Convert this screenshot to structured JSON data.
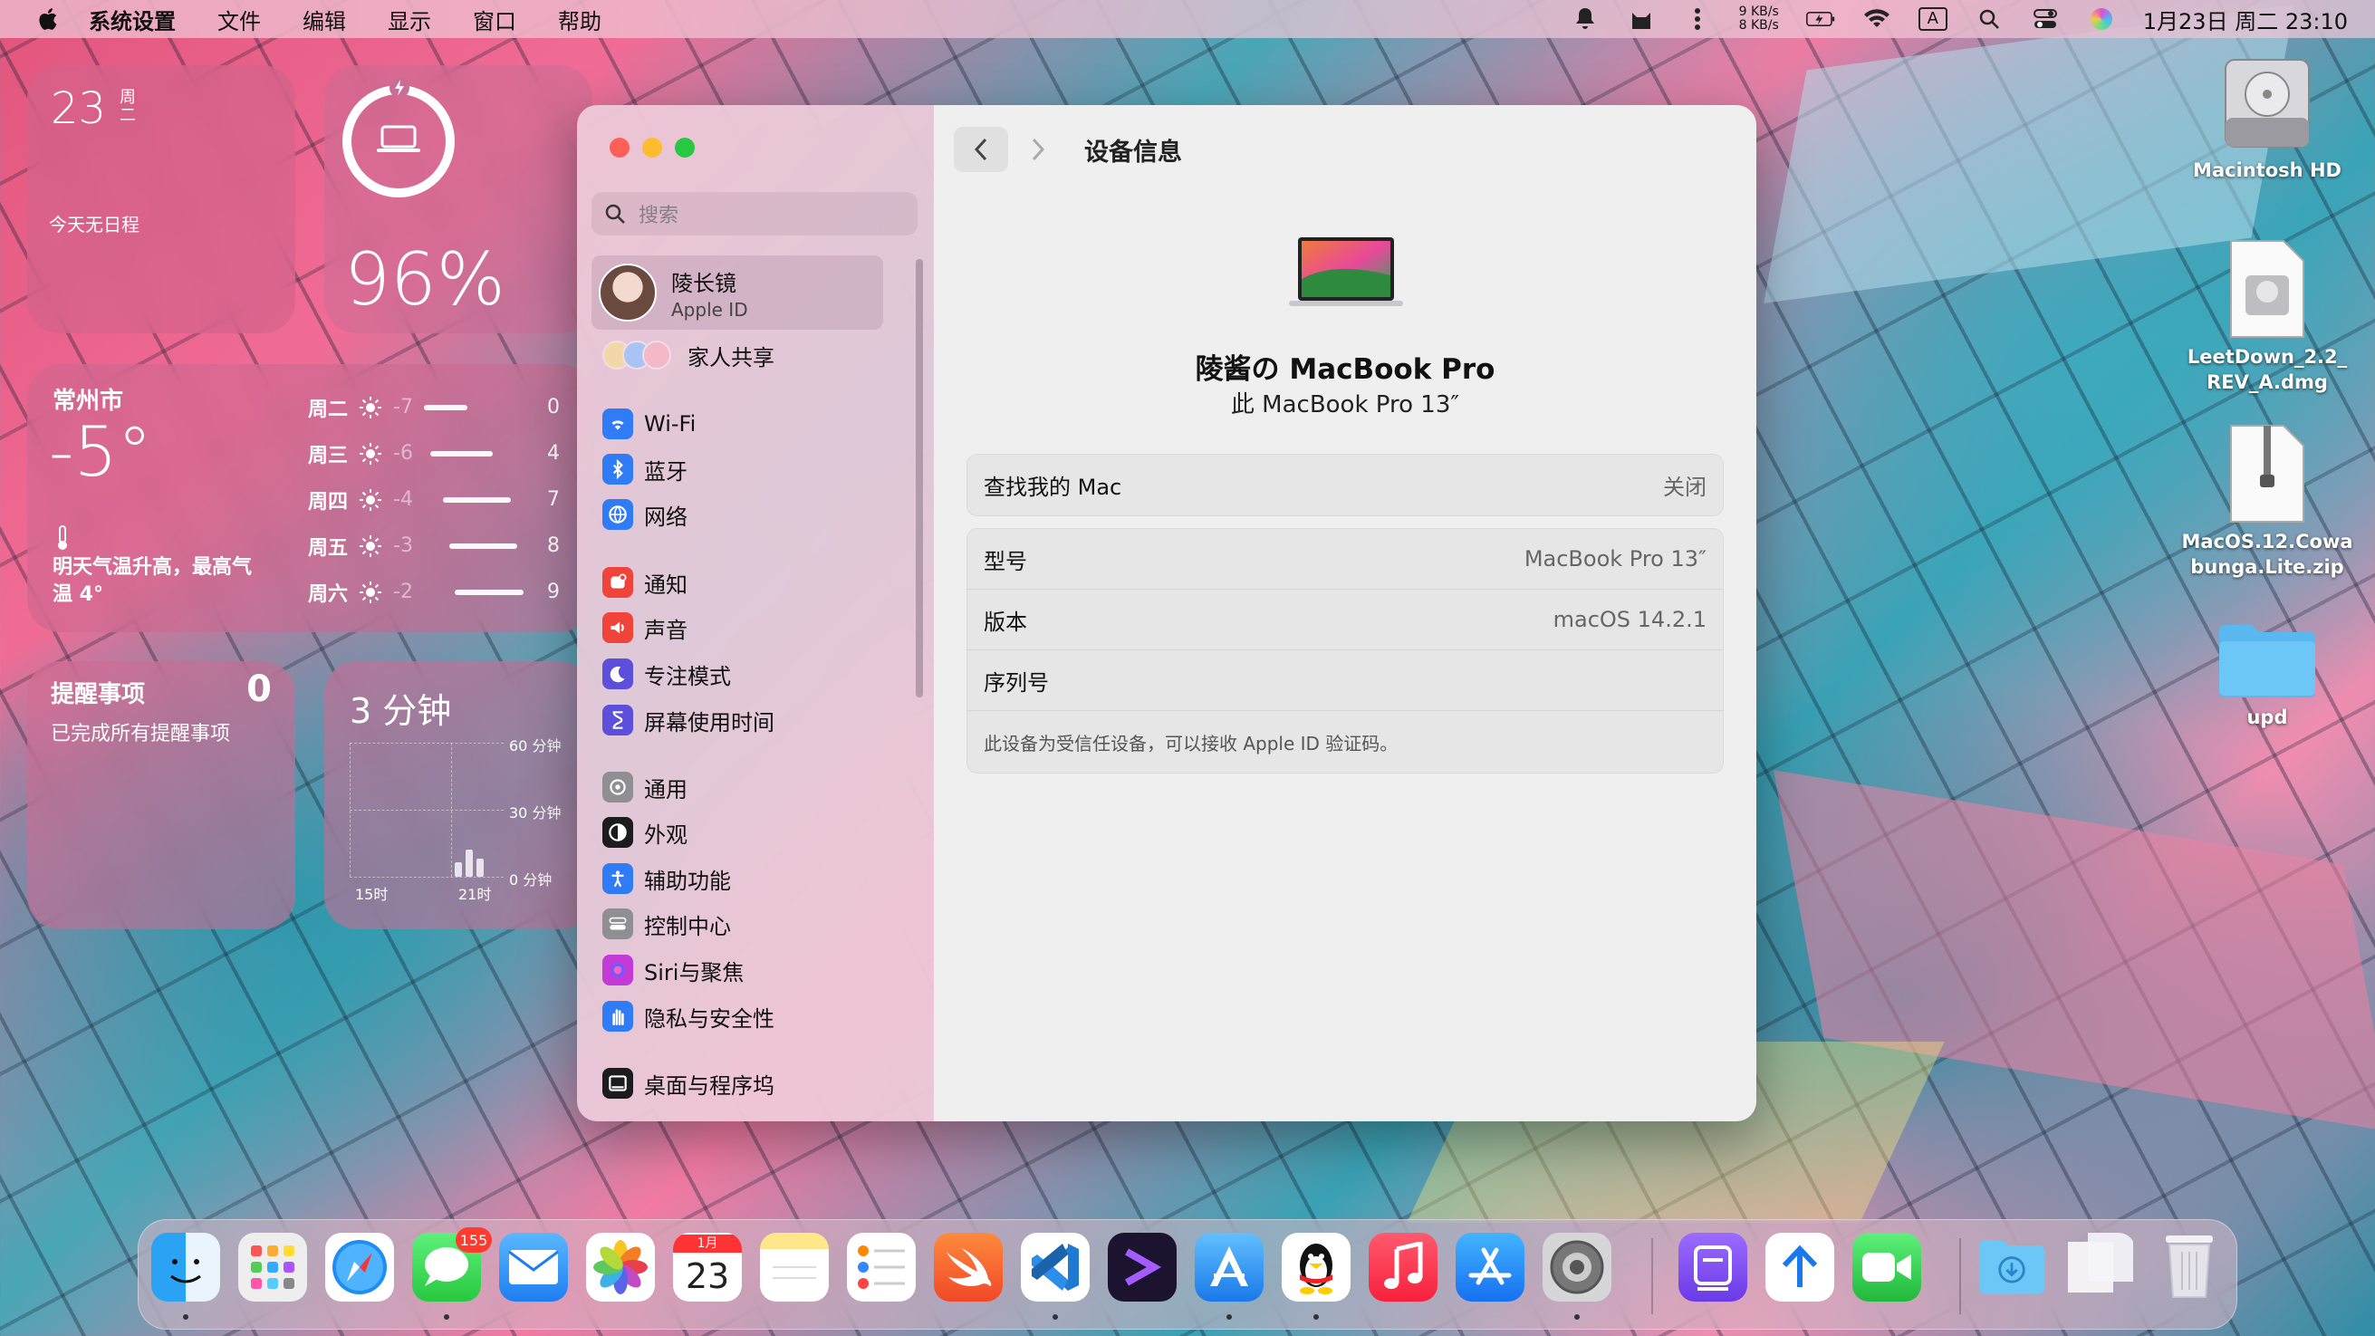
{
  "menubar": {
    "app_name": "系统设置",
    "menus": [
      "文件",
      "编辑",
      "显示",
      "窗口",
      "帮助"
    ],
    "net_up": "9 KB/s",
    "net_down": "8 KB/s",
    "input_method": "A",
    "clock": "1月23日 周二  23:10"
  },
  "widgets": {
    "calendar": {
      "day": "23",
      "weekday": "周二",
      "no_events": "今天无日程"
    },
    "battery": {
      "percent_text": "96%",
      "level": 0.96
    },
    "weather": {
      "city": "常州市",
      "temp": "-5°",
      "note": "明天气温升高，最高气温 4°",
      "forecast": [
        {
          "day": "周二",
          "low": "-7",
          "high": "0"
        },
        {
          "day": "周三",
          "low": "-6",
          "high": "4"
        },
        {
          "day": "周四",
          "low": "-4",
          "high": "7"
        },
        {
          "day": "周五",
          "low": "-3",
          "high": "8"
        },
        {
          "day": "周六",
          "low": "-2",
          "high": "9"
        }
      ]
    },
    "reminders": {
      "title": "提醒事项",
      "count": "0",
      "status": "已完成所有提醒事项"
    },
    "screen_time": {
      "total": "3  分钟",
      "grid_labels": [
        "60 分钟",
        "30 分钟",
        "0 分钟"
      ],
      "x_labels": [
        "15时",
        "21时"
      ]
    }
  },
  "settings": {
    "search_placeholder": "搜索",
    "account": {
      "name": "陵长镜",
      "subtitle": "Apple ID"
    },
    "family": "家人共享",
    "items": [
      {
        "label": "Wi-Fi",
        "icon": "wifi-icon",
        "color": "#2f7cf6"
      },
      {
        "label": "蓝牙",
        "icon": "bluetooth-icon",
        "color": "#2f7cf6"
      },
      {
        "label": "网络",
        "icon": "globe-icon",
        "color": "#2f7cf6"
      },
      {
        "label": "通知",
        "icon": "bell-icon",
        "color": "#f0443a"
      },
      {
        "label": "声音",
        "icon": "speaker-icon",
        "color": "#f0443a"
      },
      {
        "label": "专注模式",
        "icon": "moon-icon",
        "color": "#5b4fdc"
      },
      {
        "label": "屏幕使用时间",
        "icon": "hourglass-icon",
        "color": "#5b4fdc"
      },
      {
        "label": "通用",
        "icon": "gear-icon",
        "color": "#8e8e93"
      },
      {
        "label": "外观",
        "icon": "appearance-icon",
        "color": "#1c1c1e"
      },
      {
        "label": "辅助功能",
        "icon": "accessibility-icon",
        "color": "#2f7cf6"
      },
      {
        "label": "控制中心",
        "icon": "control-center-icon",
        "color": "#8e8e93"
      },
      {
        "label": "Siri与聚焦",
        "icon": "siri-icon",
        "color": "#c43ad6"
      },
      {
        "label": "隐私与安全性",
        "icon": "hand-icon",
        "color": "#2f7cf6"
      },
      {
        "label": "桌面与程序坞",
        "icon": "dock-icon",
        "color": "#1c1c1e"
      }
    ],
    "page_title": "设备信息",
    "device_name": "陵酱の MacBook Pro",
    "device_model_line": "此 MacBook Pro 13″",
    "find_my": {
      "label": "查找我的 Mac",
      "value": "关闭"
    },
    "details": [
      {
        "label": "型号",
        "value": "MacBook Pro 13″"
      },
      {
        "label": "版本",
        "value": "macOS 14.2.1"
      },
      {
        "label": "序列号",
        "value": ""
      }
    ],
    "trust_note": "此设备为受信任设备，可以接收 Apple ID 验证码。"
  },
  "desktop": [
    {
      "label": "Macintosh HD",
      "icon": "hard-drive-icon"
    },
    {
      "label": "LeetDown_2.2_REV_A.dmg",
      "icon": "disk-image-icon"
    },
    {
      "label": "MacOS.12.Cowabunga.Lite.zip",
      "icon": "zip-file-icon"
    },
    {
      "label": "upd",
      "icon": "folder-icon"
    }
  ],
  "dock": {
    "calendar_month": "1月",
    "calendar_day": "23",
    "messages_badge": "155",
    "apps": [
      "finder",
      "launchpad",
      "safari",
      "messages",
      "mail",
      "photos",
      "calendar",
      "notes",
      "reminders",
      "swift-playgrounds",
      "vscode",
      "terminal-app",
      "xcode-like",
      "qq",
      "music",
      "app-store",
      "system-settings",
      "purple-app",
      "transfer-app",
      "facetime",
      "downloads-folder",
      "desktop-stack",
      "trash"
    ]
  }
}
